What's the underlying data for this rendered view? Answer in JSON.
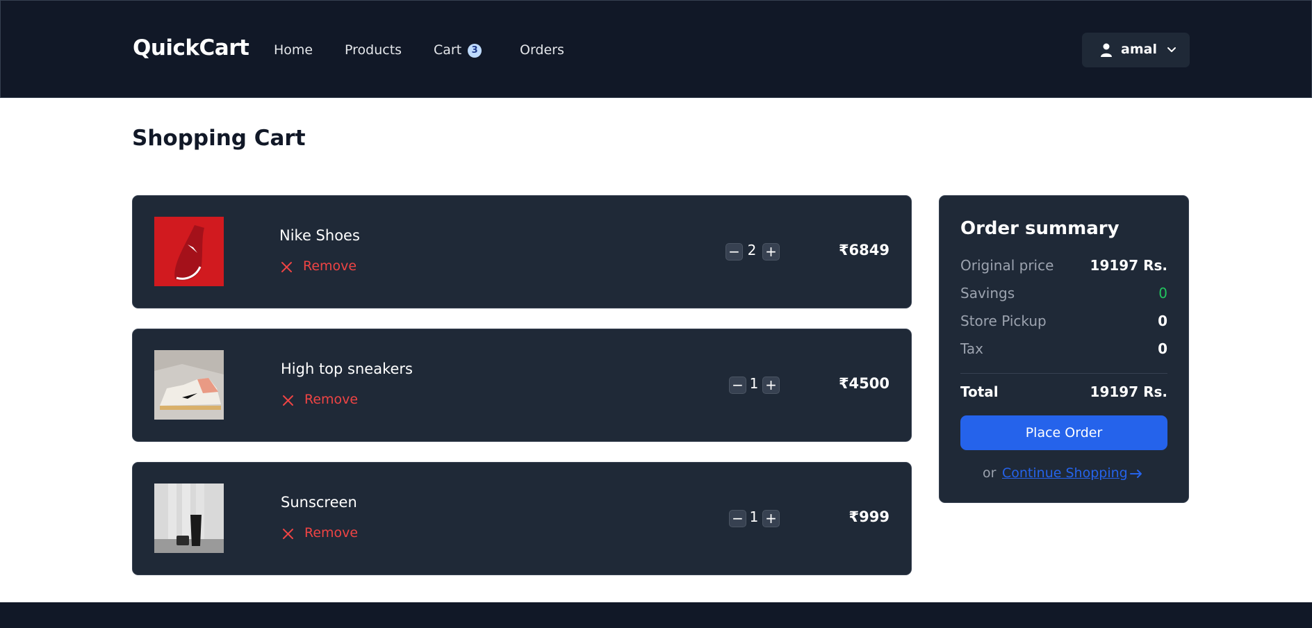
{
  "header": {
    "logo": "QuickCart",
    "nav": [
      {
        "label": "Home"
      },
      {
        "label": "Products"
      },
      {
        "label": "Cart",
        "badge": "3"
      },
      {
        "label": "Orders"
      }
    ],
    "user": {
      "name": "amal",
      "icon": "user-icon"
    }
  },
  "page": {
    "title": "Shopping Cart"
  },
  "cart": {
    "remove_label": "Remove",
    "decrement_label": "−",
    "increment_label": "+",
    "items": [
      {
        "name": "Nike Shoes",
        "quantity": "2",
        "price": "₹6849",
        "image": "red-sneaker-image"
      },
      {
        "name": "High top sneakers",
        "quantity": "1",
        "price": "₹4500",
        "image": "high-top-sneaker-image"
      },
      {
        "name": "Sunscreen",
        "quantity": "1",
        "price": "₹999",
        "image": "sunscreen-bottle-image"
      }
    ]
  },
  "summary": {
    "title": "Order summary",
    "rows": [
      {
        "label": "Original price",
        "value": "19197 Rs."
      },
      {
        "label": "Savings",
        "value": "0",
        "color": "#22c55e"
      },
      {
        "label": "Store Pickup",
        "value": "0"
      },
      {
        "label": "Tax",
        "value": "0"
      }
    ],
    "total_label": "Total",
    "total_value": "19197 Rs.",
    "place_order": "Place Order",
    "or_text": "or",
    "continue_label": "Continue Shopping"
  },
  "colors": {
    "header_bg": "#111827",
    "card_bg": "#1f2937",
    "accent": "#2563eb",
    "remove": "#ef4444",
    "savings": "#22c55e"
  }
}
